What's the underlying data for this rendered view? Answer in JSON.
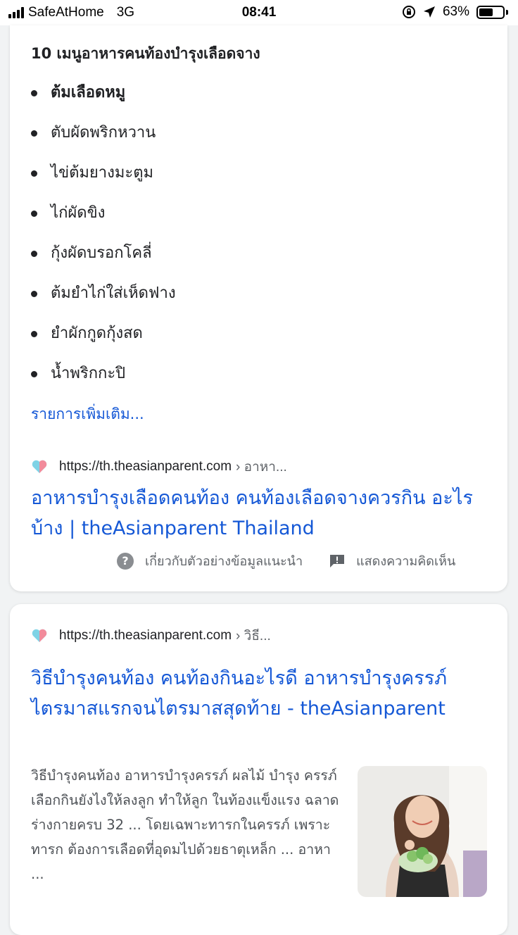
{
  "status_bar": {
    "carrier": "SafeAtHome",
    "network": "3G",
    "time": "08:41",
    "battery_percent": "63%",
    "battery_level": 0.63
  },
  "card1": {
    "list_title": "10 เมนูอาหารคนท้องบำรุงเลือดจาง",
    "items": [
      "ต้มเลือดหมู",
      "ตับผัดพริกหวาน",
      "ไข่ต้มยางมะตูม",
      "ไก่ผัดขิง",
      "กุ้งผัดบรอกโคลี่",
      "ต้มยำไก่ใส่เห็ดฟาง",
      "ยำผักกูดกุ้งสด",
      "น้ำพริกกะปิ"
    ],
    "more_link": "รายการเพิ่มเติม...",
    "source_url": "https://th.theasianparent.com",
    "source_crumb": "› อาหา...",
    "title": "อาหารบำรุงเลือดคนท้อง คนท้องเลือดจางควรกิน อะไรบ้าง | theAsianparent Thailand",
    "about_label": "เกี่ยวกับตัวอย่างข้อมูลแนะนำ",
    "feedback_label": "แสดงความคิดเห็น"
  },
  "card2": {
    "source_url": "https://th.theasianparent.com",
    "source_crumb": "› วิธี...",
    "title": "วิธีบำรุงคนท้อง คนท้องกินอะไรดี อาหารบำรุงครรภ์ ไตรมาสแรกจนไตรมาสสุดท้าย - theAsianparent",
    "snippet": "วิธีบำรุงคนท้อง อาหารบำรุงครรภ์ ผลไม้ บำรุง ครรภ์ เลือกกินยังไงให้ลงลูก ทำให้ลูก ในท้องแข็งแรง ฉลาด ร่างกายครบ 32 ... โดยเฉพาะทารกในครรภ์ เพราะทารก ต้องการเลือดที่อุดมไปด้วยธาตุเหล็ก ... อาหา ..."
  },
  "colors": {
    "link": "#1558d6",
    "text": "#202124",
    "muted": "#5f6368",
    "background": "#f1f3f4"
  },
  "icons": [
    "signal-icon",
    "orientation-lock-icon",
    "location-arrow-icon",
    "battery-icon",
    "site-favicon-heart-icon",
    "help-circle-icon",
    "feedback-icon"
  ]
}
